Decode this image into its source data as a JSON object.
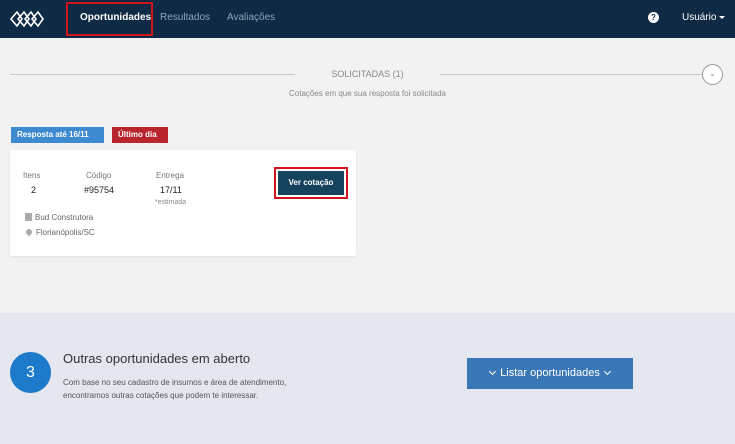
{
  "nav": {
    "items": [
      {
        "label": "Oportunidades",
        "active": true
      },
      {
        "label": "Resultados",
        "active": false
      },
      {
        "label": "Avaliações",
        "active": false
      }
    ],
    "help_icon": "?",
    "user_label": "Usuário"
  },
  "section": {
    "title": "SOLICITADAS (1)",
    "subtitle": "Cotações em que sua resposta foi solicitada",
    "collapse_symbol": "-"
  },
  "badges": {
    "deadline": "Resposta até 16/11",
    "urgency": "Último dia"
  },
  "card": {
    "itens_label": "Itens",
    "itens_value": "2",
    "codigo_label": "Código",
    "codigo_value": "#95754",
    "entrega_label": "Entrega",
    "entrega_value": "17/11",
    "entrega_note": "*estimada",
    "company": "Bud Construtora",
    "location": "Florianópolis/SC",
    "button_label": "Ver cotação"
  },
  "others": {
    "count": "3",
    "title": "Outras oportunidades em aberto",
    "desc_line1": "Com base no seu cadastro de insumos e área de atendimento,",
    "desc_line2": "encontramos outras cotações que podem te interessar.",
    "button_label": "Listar oportunidades"
  },
  "colors": {
    "topbar": "#0f2a44",
    "accent_blue": "#3a77b7",
    "badge_blue": "#3d8ad0",
    "badge_red": "#b8252e",
    "button_dark": "#15435e",
    "highlight": "#d0151d"
  },
  "icons": {
    "logo": "logo-icon",
    "help": "help-icon",
    "building": "building-icon",
    "pin": "map-pin-icon"
  }
}
